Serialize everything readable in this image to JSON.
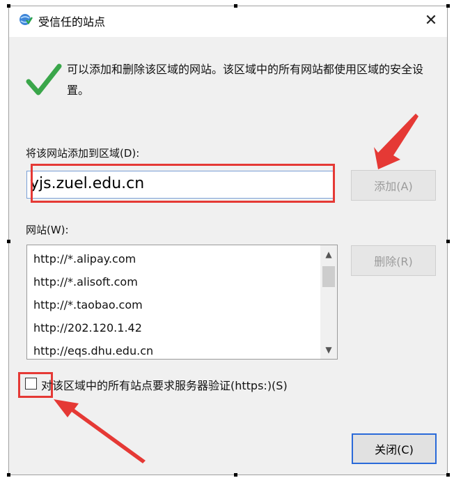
{
  "window": {
    "title": "受信任的站点",
    "close_glyph": "✕"
  },
  "description": "可以添加和删除该区域的网站。该区域中的所有网站都使用区域的安全设置。",
  "add_section": {
    "label": "将该网站添加到区域(D):",
    "input_value": "yjs.zuel.edu.cn",
    "add_button": "添加(A)"
  },
  "sites_section": {
    "label": "网站(W):",
    "sites": [
      "http://*.alipay.com",
      "http://*.alisoft.com",
      "http://*.taobao.com",
      "http://202.120.1.42",
      "http://eqs.dhu.edu.cn"
    ],
    "remove_button": "删除(R)",
    "scroll_up_glyph": "▲",
    "scroll_down_glyph": "▼"
  },
  "https_option": {
    "label": "对该区域中的所有站点要求服务器验证(https:)(S)",
    "checked": false
  },
  "close_button": "关闭(C)",
  "colors": {
    "highlight_red": "#e53935",
    "check_green": "#3aa64a",
    "primary_border": "#2a6ad9"
  }
}
